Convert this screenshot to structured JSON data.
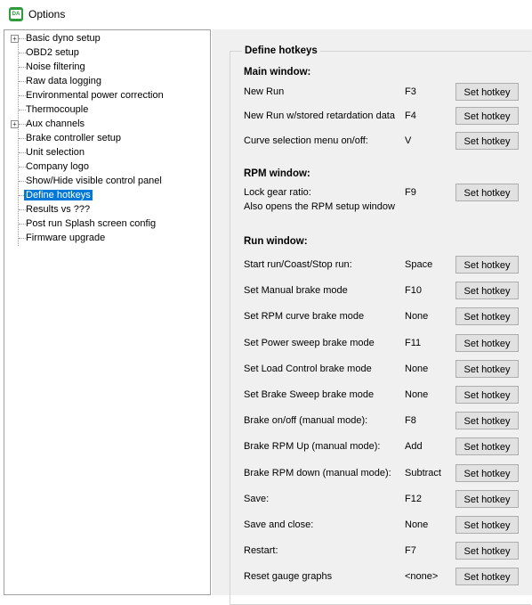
{
  "window": {
    "title": "Options"
  },
  "tree": {
    "items": [
      {
        "label": "Basic dyno setup",
        "expandable": true
      },
      {
        "label": "OBD2 setup"
      },
      {
        "label": "Noise filtering"
      },
      {
        "label": "Raw data logging"
      },
      {
        "label": "Environmental power correction"
      },
      {
        "label": "Thermocouple"
      },
      {
        "label": "Aux channels",
        "expandable": true
      },
      {
        "label": "Brake controller setup"
      },
      {
        "label": "Unit selection"
      },
      {
        "label": "Company logo"
      },
      {
        "label": "Show/Hide visible control panel"
      },
      {
        "label": "Define hotkeys",
        "selected": true
      },
      {
        "label": "Results vs ???"
      },
      {
        "label": "Post run Splash screen config"
      },
      {
        "label": "Firmware upgrade"
      }
    ],
    "expander_symbol": "+"
  },
  "panel": {
    "group_title": "Define hotkeys",
    "button_label": "Set hotkey",
    "main_window": {
      "title": "Main window:",
      "rows": [
        {
          "label": "New Run",
          "key": "F3"
        },
        {
          "label": "New Run w/stored retardation data",
          "key": "F4"
        },
        {
          "label": "Curve selection menu on/off:",
          "key": "V"
        }
      ]
    },
    "rpm_window": {
      "title": "RPM window:",
      "rows": [
        {
          "label": "Lock gear ratio:",
          "label2": "Also opens the RPM setup window",
          "key": "F9"
        }
      ]
    },
    "run_window": {
      "title": "Run window:",
      "rows": [
        {
          "label": "Start run/Coast/Stop run:",
          "key": "Space"
        },
        {
          "label": "Set Manual brake mode",
          "key": "F10"
        },
        {
          "label": "Set RPM curve brake mode",
          "key": "None"
        },
        {
          "label": "Set Power sweep brake mode",
          "key": "F11"
        },
        {
          "label": "Set Load Control brake mode",
          "key": "None"
        },
        {
          "label": "Set Brake Sweep brake mode",
          "key": "None"
        },
        {
          "label": "Brake on/off (manual mode):",
          "key": "F8"
        },
        {
          "label": "Brake RPM Up (manual mode):",
          "key": "Add"
        },
        {
          "label": "Brake RPM down (manual mode):",
          "key": "Subtract"
        },
        {
          "label": "Save:",
          "key": "F12"
        },
        {
          "label": "Save and close:",
          "key": "None"
        },
        {
          "label": "Restart:",
          "key": "F7"
        },
        {
          "label": "Reset gauge graphs",
          "key": "<none>"
        }
      ]
    }
  }
}
